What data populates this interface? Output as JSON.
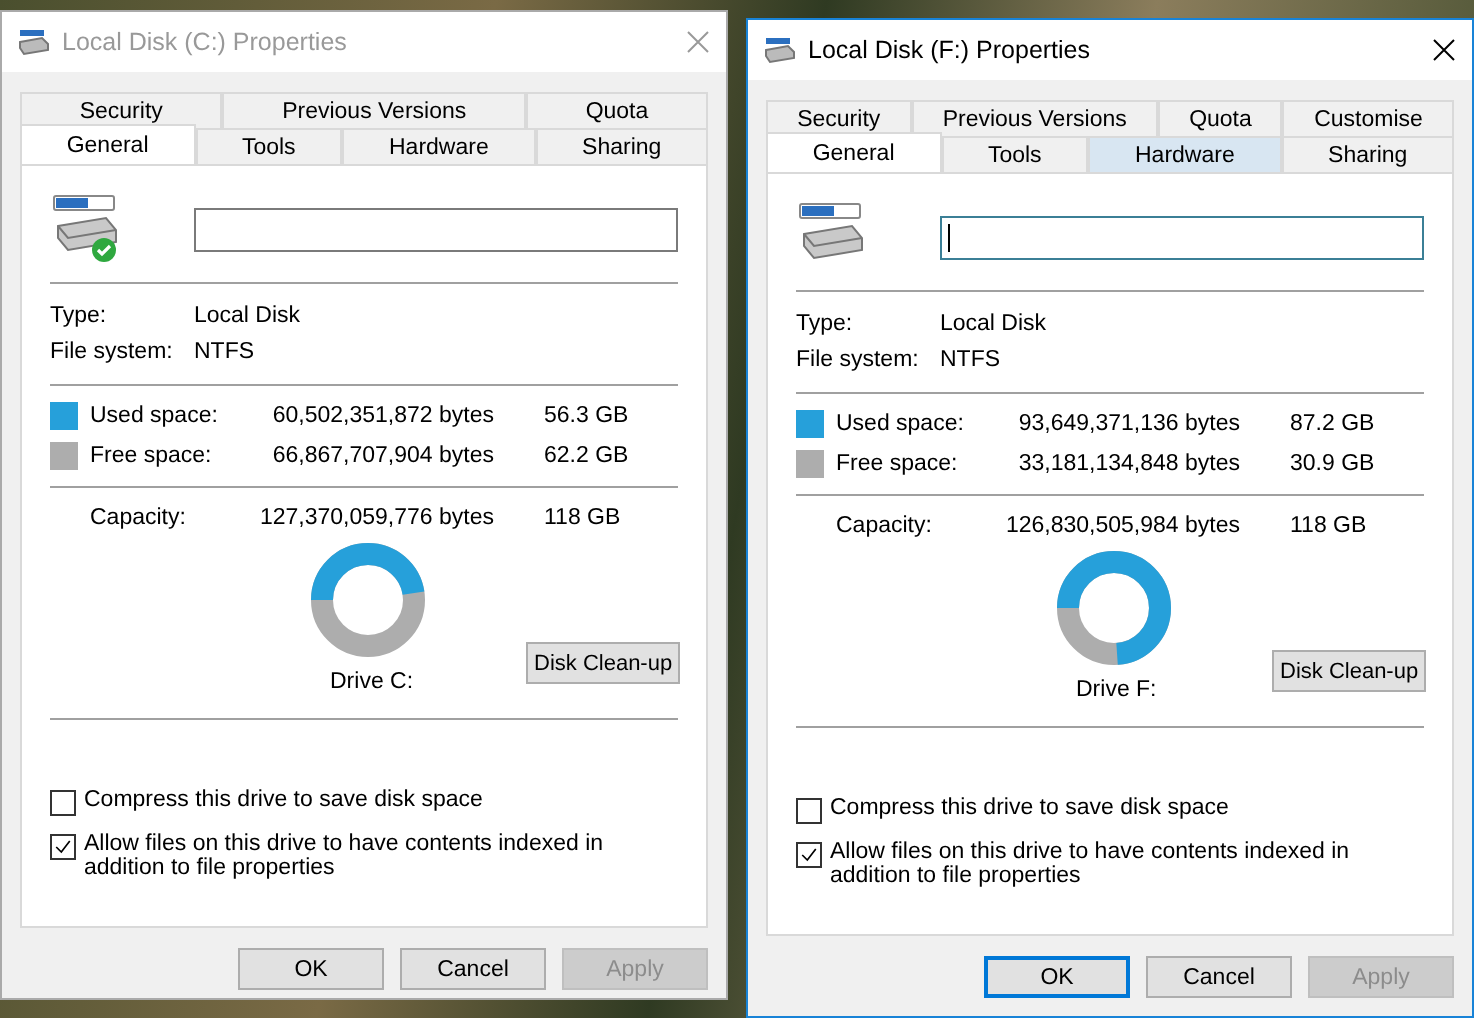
{
  "windows": [
    {
      "title": "Local Disk (C:) Properties",
      "active": false,
      "status_badge": true,
      "tab_rows": [
        [
          {
            "label": "Security",
            "selected": false,
            "hovered": false
          },
          {
            "label": "Previous Versions",
            "selected": false,
            "hovered": false
          },
          {
            "label": "Quota",
            "selected": false,
            "hovered": false
          }
        ],
        [
          {
            "label": "General",
            "selected": true,
            "hovered": false
          },
          {
            "label": "Tools",
            "selected": false,
            "hovered": false
          },
          {
            "label": "Hardware",
            "selected": false,
            "hovered": false
          },
          {
            "label": "Sharing",
            "selected": false,
            "hovered": false
          }
        ]
      ],
      "name_field": {
        "focused": false
      },
      "info": [
        {
          "label": "Type:",
          "value": "Local Disk"
        },
        {
          "label": "File system:",
          "value": "NTFS"
        }
      ],
      "space": [
        {
          "label": "Used space:",
          "bytes": "60,502,351,872 bytes",
          "size": "56.3 GB",
          "color": "#26a0da"
        },
        {
          "label": "Free space:",
          "bytes": "66,867,707,904 bytes",
          "size": "62.2 GB",
          "color": "#adadad"
        }
      ],
      "capacity": {
        "label": "Capacity:",
        "bytes": "127,370,059,776 bytes",
        "size": "118 GB"
      },
      "usage": {
        "level": 0.475
      },
      "drive_label": "Drive C:",
      "cleanup_button": "Disk Clean-up",
      "options": [
        {
          "label": "Compress this drive to save disk space",
          "checked": false
        },
        {
          "label": "Allow files on this drive to have contents indexed in addition to file properties",
          "checked": true
        }
      ],
      "buttons": [
        {
          "label": "OK",
          "default": false,
          "disabled": false
        },
        {
          "label": "Cancel",
          "default": false,
          "disabled": false
        },
        {
          "label": "Apply",
          "default": false,
          "disabled": true
        }
      ]
    },
    {
      "title": "Local Disk (F:) Properties",
      "active": true,
      "status_badge": false,
      "tab_rows": [
        [
          {
            "label": "Security",
            "selected": false,
            "hovered": false
          },
          {
            "label": "Previous Versions",
            "selected": false,
            "hovered": false
          },
          {
            "label": "Quota",
            "selected": false,
            "hovered": false
          },
          {
            "label": "Customise",
            "selected": false,
            "hovered": false
          }
        ],
        [
          {
            "label": "General",
            "selected": true,
            "hovered": false
          },
          {
            "label": "Tools",
            "selected": false,
            "hovered": false
          },
          {
            "label": "Hardware",
            "selected": false,
            "hovered": true
          },
          {
            "label": "Sharing",
            "selected": false,
            "hovered": false
          }
        ]
      ],
      "name_field": {
        "focused": true
      },
      "info": [
        {
          "label": "Type:",
          "value": "Local Disk"
        },
        {
          "label": "File system:",
          "value": "NTFS"
        }
      ],
      "space": [
        {
          "label": "Used space:",
          "bytes": "93,649,371,136 bytes",
          "size": "87.2 GB",
          "color": "#26a0da"
        },
        {
          "label": "Free space:",
          "bytes": "33,181,134,848 bytes",
          "size": "30.9 GB",
          "color": "#adadad"
        }
      ],
      "capacity": {
        "label": "Capacity:",
        "bytes": "126,830,505,984 bytes",
        "size": "118 GB"
      },
      "usage": {
        "level": 0.738
      },
      "drive_label": "Drive F:",
      "cleanup_button": "Disk Clean-up",
      "options": [
        {
          "label": "Compress this drive to save disk space",
          "checked": false
        },
        {
          "label": "Allow files on this drive to have contents indexed in addition to file properties",
          "checked": true
        }
      ],
      "buttons": [
        {
          "label": "OK",
          "default": true,
          "disabled": false
        },
        {
          "label": "Cancel",
          "default": false,
          "disabled": false
        },
        {
          "label": "Apply",
          "default": false,
          "disabled": true
        }
      ]
    }
  ]
}
